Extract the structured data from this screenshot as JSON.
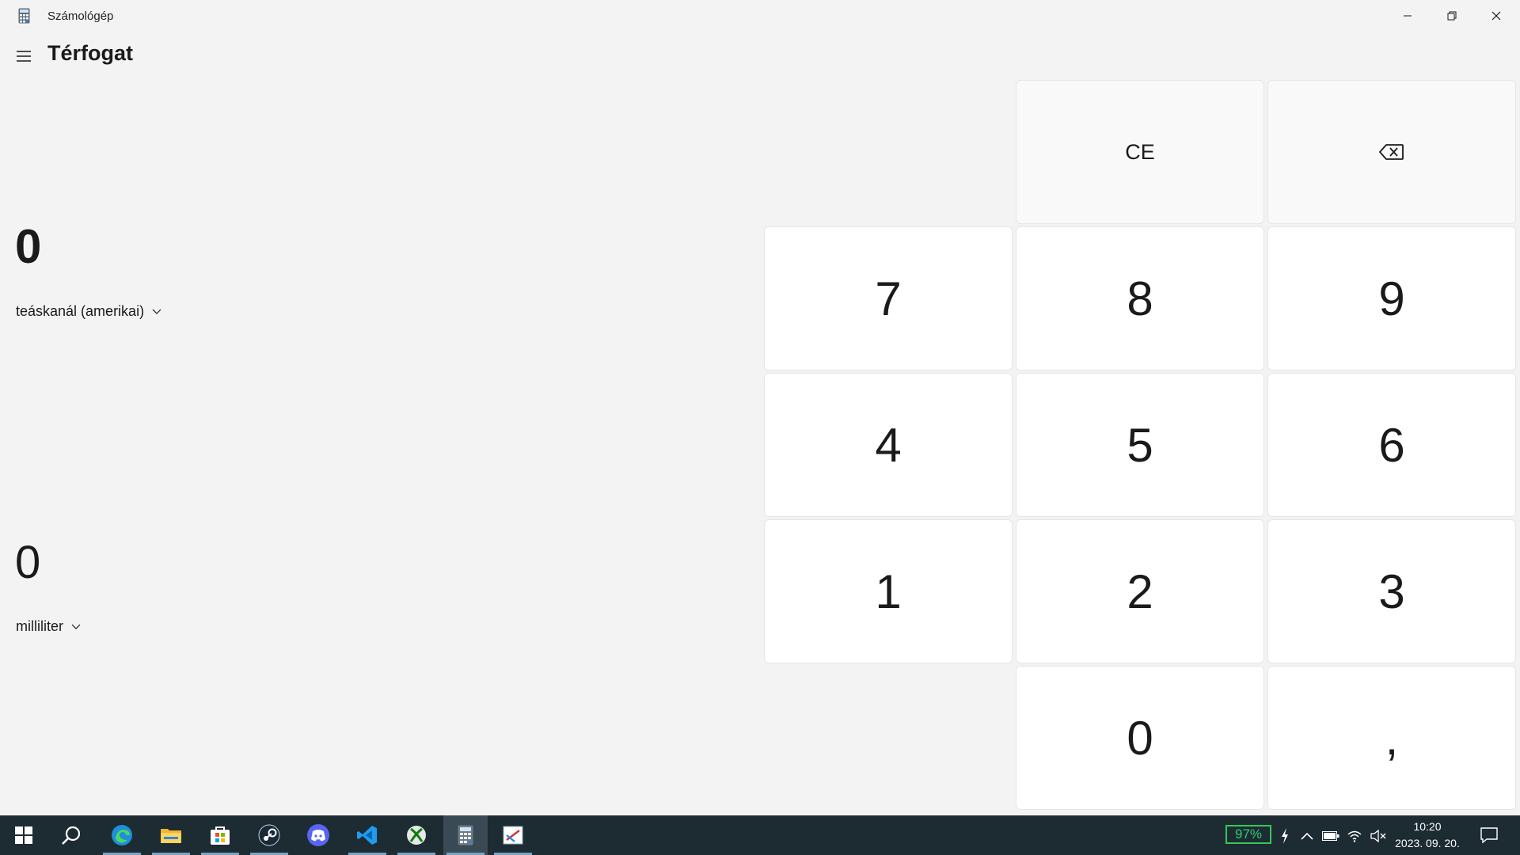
{
  "window": {
    "title": "Számológép",
    "controls": [
      "minimize-icon",
      "restore-icon",
      "close-icon"
    ]
  },
  "header": {
    "menu_icon": "hamburger-icon",
    "mode_title": "Térfogat"
  },
  "converter": {
    "from": {
      "value": "0",
      "unit": "teáskanál (amerikai)"
    },
    "to": {
      "value": "0",
      "unit": "milliliter"
    }
  },
  "keypad": {
    "ce": "CE",
    "backspace_icon": "backspace-icon",
    "k7": "7",
    "k8": "8",
    "k9": "9",
    "k4": "4",
    "k5": "5",
    "k6": "6",
    "k1": "1",
    "k2": "2",
    "k3": "3",
    "k0": "0",
    "decimal": ","
  },
  "taskbar": {
    "apps": [
      "start-icon",
      "search-icon",
      "edge-icon",
      "file-explorer-icon",
      "store-icon",
      "steam-icon",
      "discord-icon",
      "vscode-icon",
      "xbox-icon",
      "calculator-icon",
      "snipping-tool-icon"
    ],
    "active_app": "calculator-icon",
    "battery_percent": "97%",
    "time": "10:20",
    "date": "2023. 09. 20."
  },
  "colors": {
    "background": "#f3f3f3",
    "key": "#ffffff",
    "taskbar": "#1d2b33",
    "battery": "#2ecc71"
  }
}
